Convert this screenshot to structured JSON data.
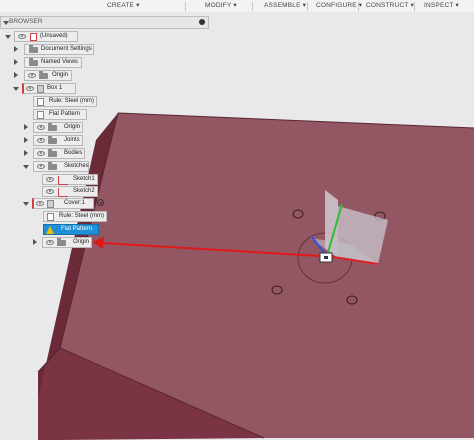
{
  "toolbar": {
    "items": [
      "CREATE ▾",
      "MODIFY ▾",
      "ASSEMBLE ▾",
      "CONFIGURE ▾",
      "CONSTRUCT ▾",
      "INSPECT ▾"
    ]
  },
  "browser": {
    "title": "BROWSER",
    "rows": [
      {
        "label": "(Unsaved)"
      },
      {
        "label": "Document Settings"
      },
      {
        "label": "Named Views"
      },
      {
        "label": "Origin"
      },
      {
        "label": "Box 1"
      },
      {
        "label": "Rule: Steel (mm)"
      },
      {
        "label": "Flat Pattern"
      },
      {
        "label": "Origin"
      },
      {
        "label": "Joints"
      },
      {
        "label": "Bodies"
      },
      {
        "label": "Sketches"
      },
      {
        "label": "Sketch1"
      },
      {
        "label": "Sketch2"
      },
      {
        "label": "Cover:1"
      },
      {
        "label": "Rule: Steel (mm)"
      },
      {
        "label": "Flat Pattern"
      },
      {
        "label": "Origin"
      }
    ]
  },
  "colors": {
    "body_top": "#8a4a57",
    "body_front": "#78303f",
    "body_edge": "#5a2530",
    "selected_row": "#1f8fd6",
    "arrow": "#e01818",
    "axis_green": "#2fbf2f",
    "axis_blue": "#3050e0"
  },
  "icons": [
    "eye-icon",
    "folder-icon",
    "document-icon",
    "sketch-icon",
    "warning-icon",
    "radio-target-icon",
    "close-icon",
    "component-icon"
  ]
}
